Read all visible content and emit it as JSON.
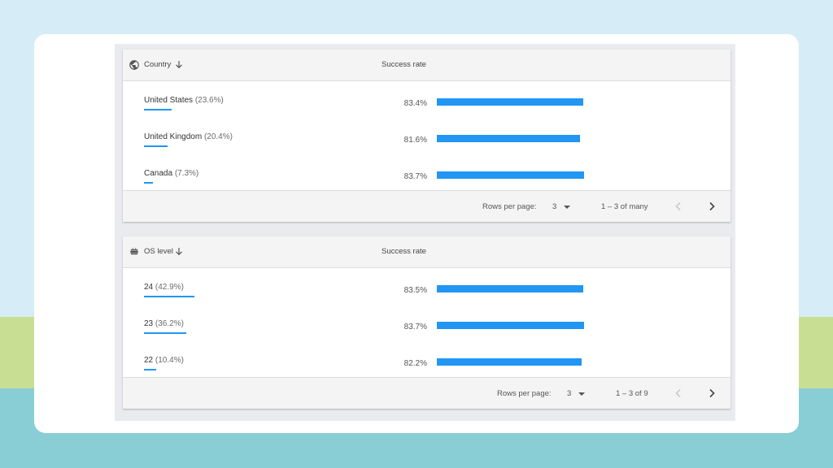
{
  "country_table": {
    "header_label": "Country",
    "rate_header": "Success rate",
    "rows": [
      {
        "name": "United States",
        "pct": "(23.6%)",
        "share": 23.6,
        "rate": "83.4%",
        "rate_value": 83.4
      },
      {
        "name": "United Kingdom",
        "pct": "(20.4%)",
        "share": 20.4,
        "rate": "81.6%",
        "rate_value": 81.6
      },
      {
        "name": "Canada",
        "pct": "(7.3%)",
        "share": 7.3,
        "rate": "83.7%",
        "rate_value": 83.7
      }
    ],
    "footer": {
      "rows_per_page_label": "Rows per page:",
      "rows_per_page_value": "3",
      "range": "1 – 3 of  many"
    }
  },
  "os_table": {
    "header_label": "OS level",
    "rate_header": "Success rate",
    "rows": [
      {
        "name": "24",
        "pct": "(42.9%)",
        "share": 42.9,
        "rate": "83.5%",
        "rate_value": 83.5
      },
      {
        "name": "23",
        "pct": "(36.2%)",
        "share": 36.2,
        "rate": "83.7%",
        "rate_value": 83.7
      },
      {
        "name": "22",
        "pct": "(10.4%)",
        "share": 10.4,
        "rate": "82.2%",
        "rate_value": 82.2
      }
    ],
    "footer": {
      "rows_per_page_label": "Rows per page:",
      "rows_per_page_value": "3",
      "range": "1 – 3 of  9"
    }
  },
  "icons": {
    "country_header": "globe-icon",
    "os_header": "android-icon",
    "sort": "arrow-down-icon",
    "dropdown": "caret-down-icon",
    "prev": "chevron-left-icon",
    "next": "chevron-right-icon"
  },
  "colors": {
    "bar": "#2196f3",
    "header_bg": "#f4f4f4",
    "panel_bg": "#e9ebee",
    "card_bg": "#ffffff",
    "bg_sky": "#d6ecf7",
    "bg_green": "#c8df93",
    "bg_teal": "#89cdd5"
  }
}
